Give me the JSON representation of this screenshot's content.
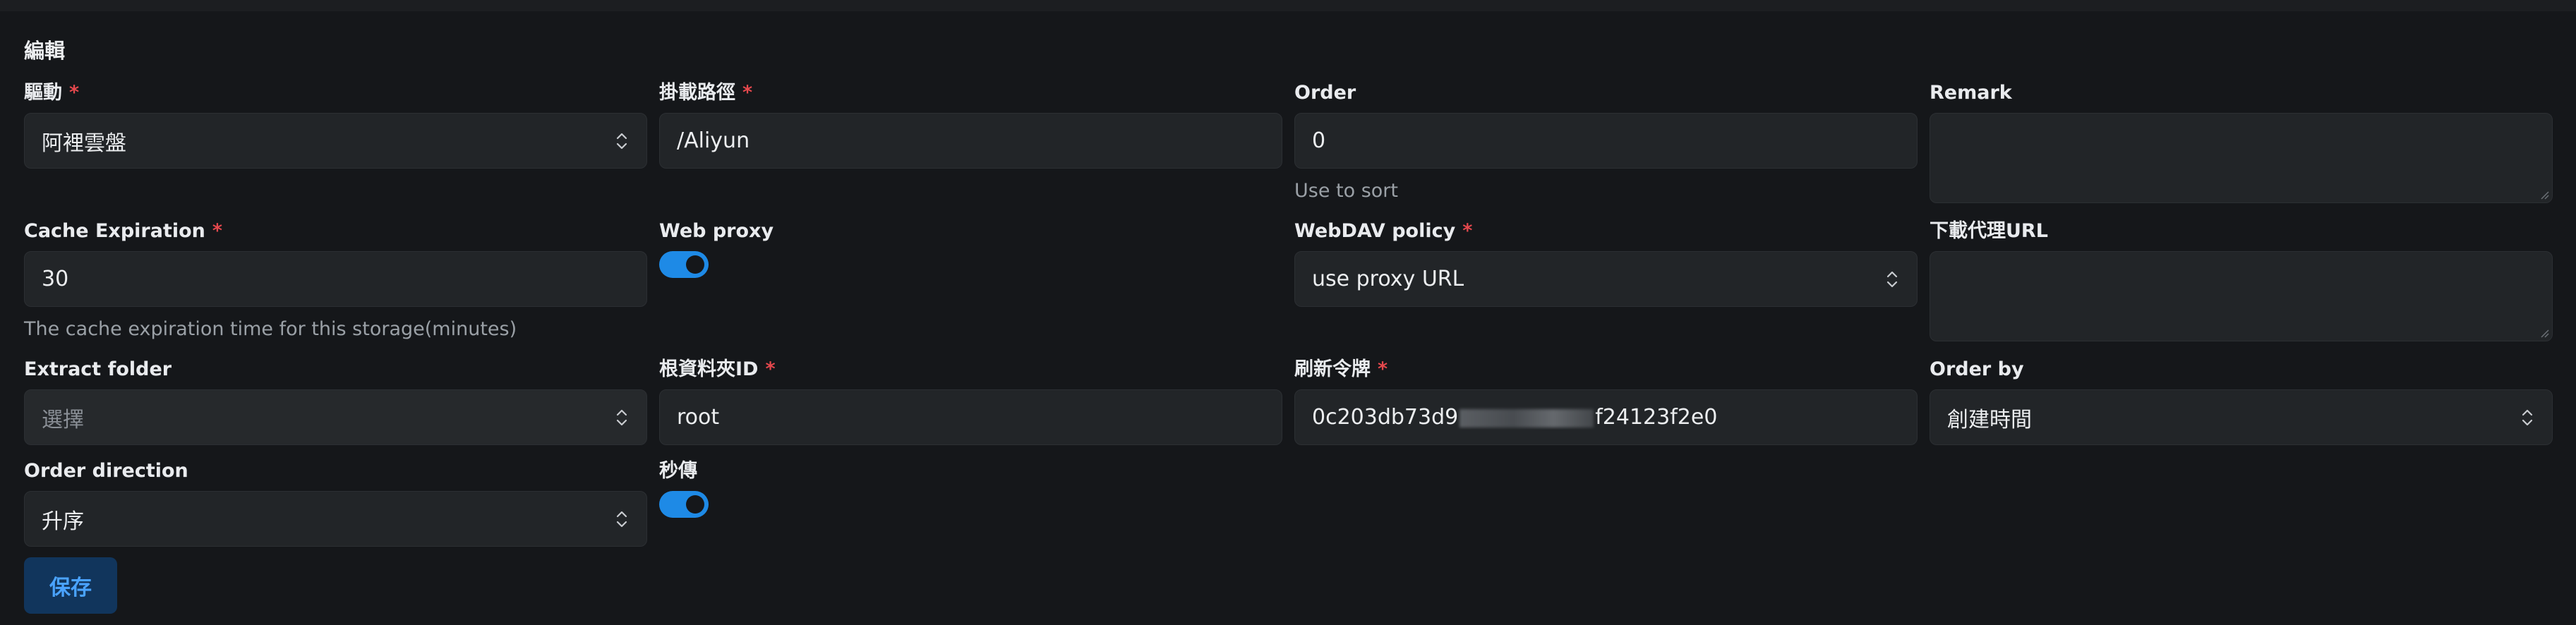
{
  "page": {
    "title": "編輯"
  },
  "fields": {
    "driver": {
      "label": "驅動",
      "value": "阿裡雲盤",
      "required": "*"
    },
    "mount_path": {
      "label": "掛載路徑",
      "value": "/Aliyun",
      "required": "*"
    },
    "order": {
      "label": "Order",
      "value": "0",
      "helper": "Use to sort"
    },
    "remark": {
      "label": "Remark",
      "value": ""
    },
    "cache_expiration": {
      "label": "Cache Expiration",
      "value": "30",
      "required": "*",
      "helper": "The cache expiration time for this storage(minutes)"
    },
    "web_proxy": {
      "label": "Web proxy",
      "state": "on"
    },
    "webdav_policy": {
      "label": "WebDAV policy",
      "value": "use proxy URL",
      "required": "*"
    },
    "download_proxy_url": {
      "label": "下載代理URL",
      "value": ""
    },
    "extract_folder": {
      "label": "Extract folder",
      "placeholder": "選擇"
    },
    "root_folder_id": {
      "label": "根資料夾ID",
      "value": "root",
      "required": "*"
    },
    "refresh_token": {
      "label": "刷新令牌",
      "value_prefix": "0c203db73d9",
      "value_suffix": "f24123f2e0",
      "required": "*"
    },
    "order_by": {
      "label": "Order by",
      "value": "創建時間"
    },
    "order_direction": {
      "label": "Order direction",
      "value": "升序"
    },
    "rapid_upload": {
      "label": "秒傳",
      "state": "on"
    }
  },
  "actions": {
    "save_label": "保存"
  },
  "colors": {
    "background": "#15171a",
    "input_bg": "#222528",
    "required": "#e5484d",
    "toggle_on": "#1e8ae6",
    "save_bg": "#11355c",
    "save_text": "#4aa3ff"
  }
}
